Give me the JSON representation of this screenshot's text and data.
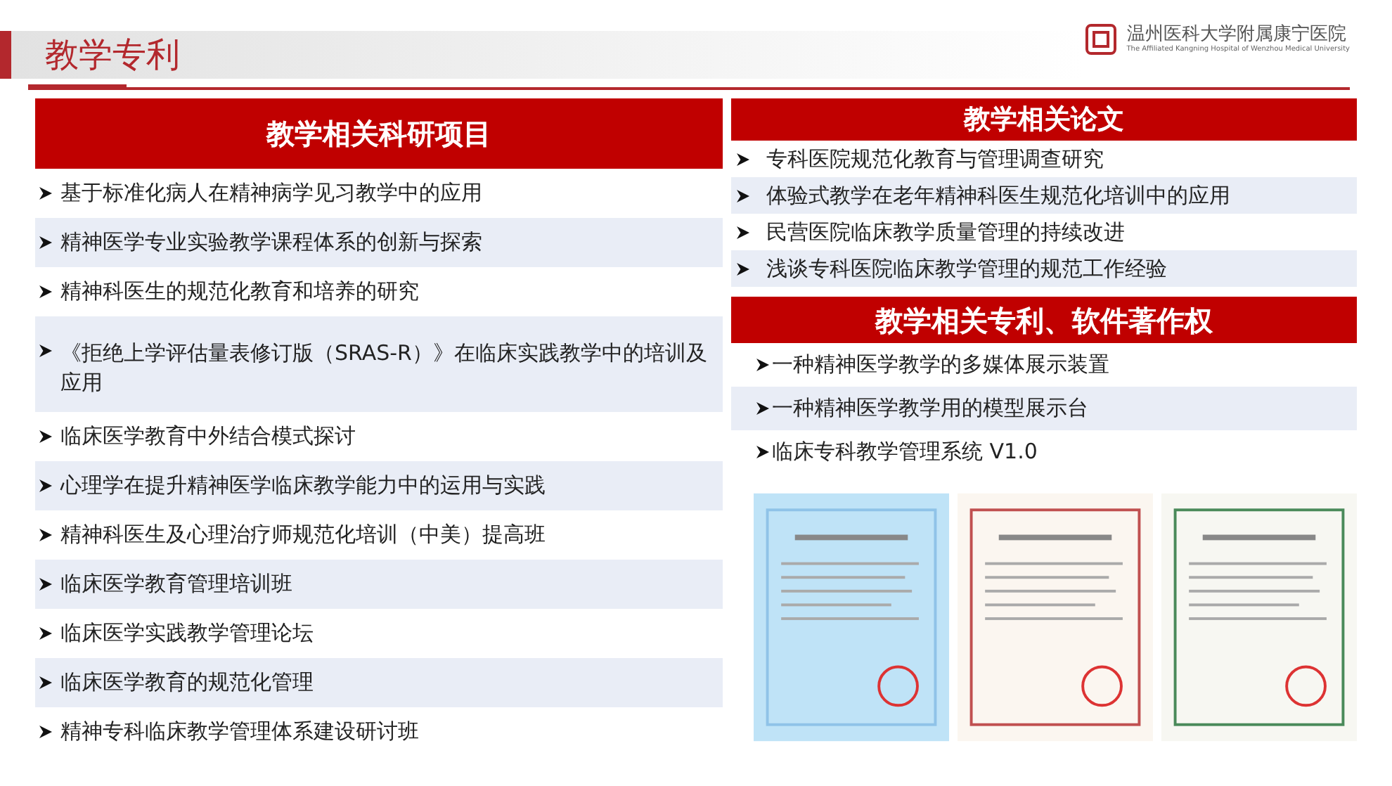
{
  "header": {
    "title": "教学专利",
    "logo_name": "温州医科大学附属康宁医院",
    "logo_subtitle": "The Affiliated Kangning Hospital of Wenzhou Medical University"
  },
  "projects": {
    "title": "教学相关科研项目",
    "items": [
      "基于标准化病人在精神病学见习教学中的应用",
      "精神医学专业实验教学课程体系的创新与探索",
      "精神科医生的规范化教育和培养的研究",
      "《拒绝上学评估量表修订版（SRAS-R）》在临床实践教学中的培训及应用",
      "临床医学教育中外结合模式探讨",
      "心理学在提升精神医学临床教学能力中的运用与实践",
      "精神科医生及心理治疗师规范化培训（中美）提高班",
      "临床医学教育管理培训班",
      "临床医学实践教学管理论坛",
      "临床医学教育的规范化管理",
      "精神专科临床教学管理体系建设研讨班"
    ]
  },
  "papers": {
    "title": "教学相关论文",
    "items": [
      "专科医院规范化教育与管理调查研究",
      "体验式教学在老年精神科医生规范化培训中的应用",
      "民营医院临床教学质量管理的持续改进",
      "浅谈专科医院临床教学管理的规范工作经验"
    ]
  },
  "patents": {
    "title": "教学相关专利、软件著作权",
    "items": [
      "一种精神医学教学的多媒体展示装置",
      "一种精神医学教学用的模型展示台",
      "临床专科教学管理系统 V1.0"
    ]
  },
  "certificates": [
    {
      "kind": "blue"
    },
    {
      "kind": "red"
    },
    {
      "kind": "green"
    }
  ]
}
